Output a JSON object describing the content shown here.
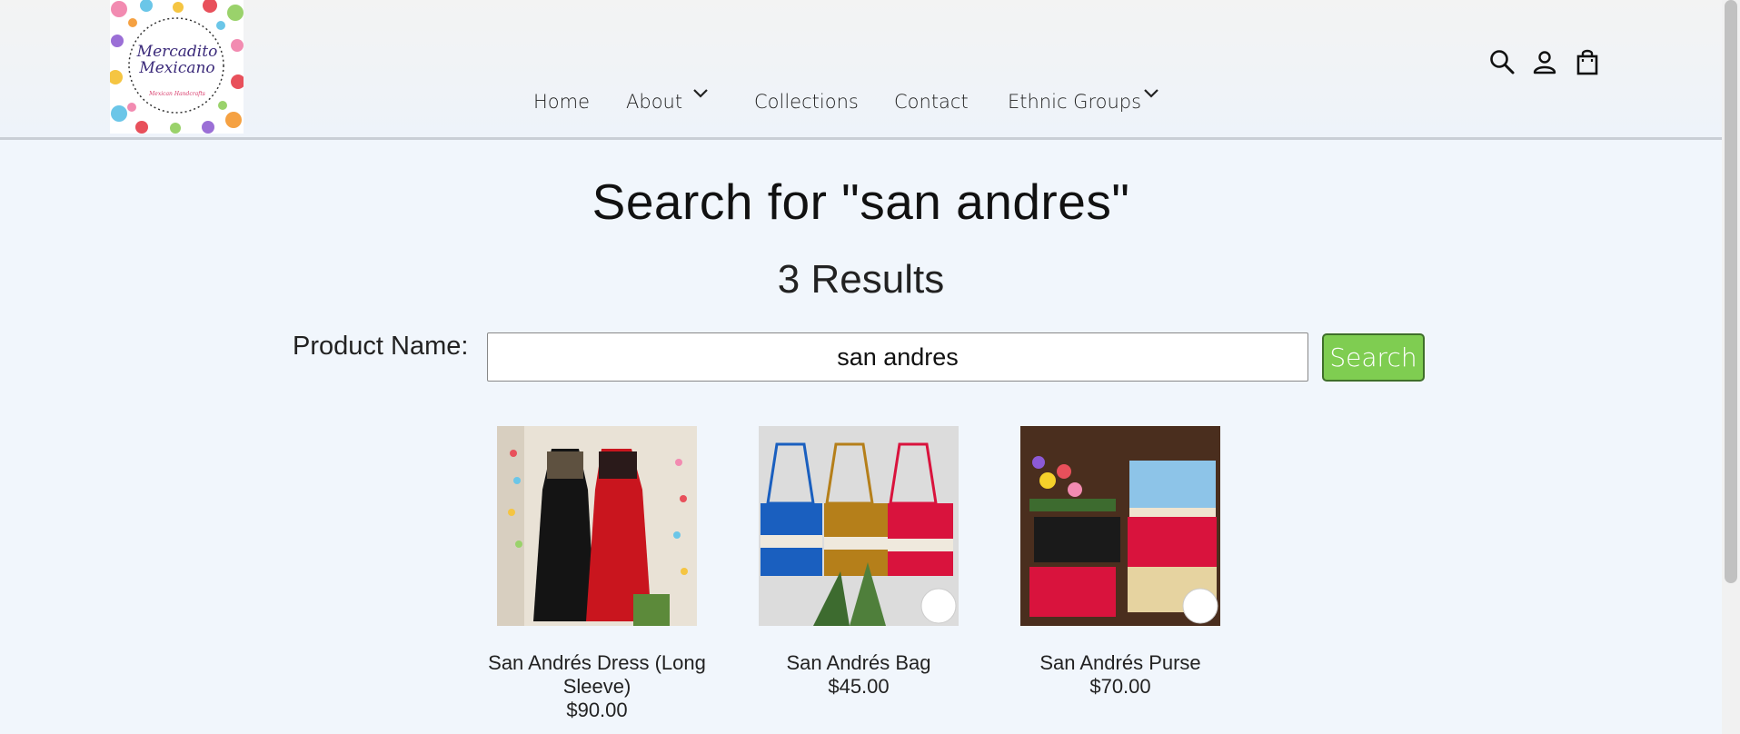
{
  "header": {
    "logo_text": "Mercadito Mexicano",
    "logo_subtext": "Mexican Handcrafts",
    "nav": [
      {
        "label": "Home"
      },
      {
        "label": "About"
      },
      {
        "label": "Collections"
      },
      {
        "label": "Contact"
      },
      {
        "label": "Ethnic Groups"
      }
    ],
    "icons": [
      "search-icon",
      "account-icon",
      "cart-icon"
    ]
  },
  "main": {
    "title": "Search for \"san andres\"",
    "results_count": "3 Results",
    "search": {
      "label": "Product Name:",
      "value": "san andres",
      "button_label": "Search"
    },
    "products": [
      {
        "name": "San Andrés Dress (Long Sleeve)",
        "price": "$90.00"
      },
      {
        "name": "San Andrés Bag",
        "price": "$45.00"
      },
      {
        "name": "San Andrés Purse",
        "price": "$70.00"
      }
    ]
  },
  "colors": {
    "search_button": "#7fcd51",
    "background": "#f1f6fc"
  }
}
